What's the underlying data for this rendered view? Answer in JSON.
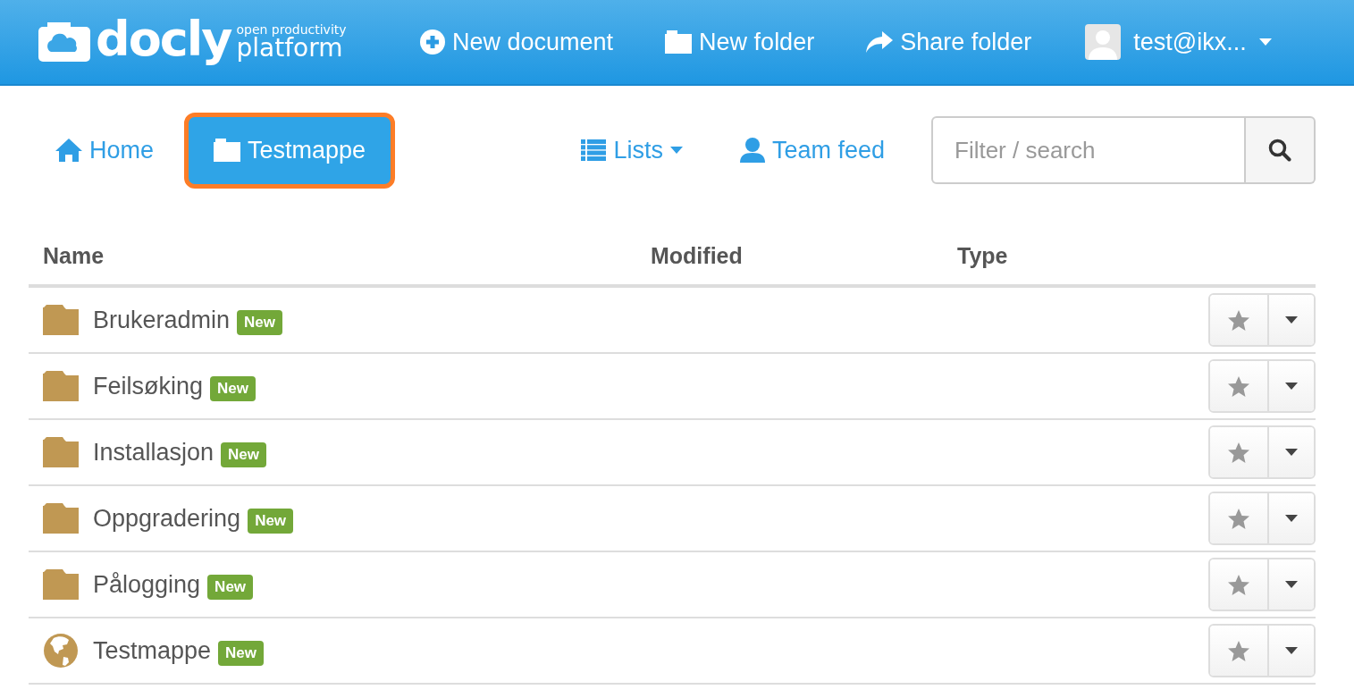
{
  "header": {
    "logo": {
      "name": "docly",
      "tagline_top": "open productivity",
      "tagline_bottom": "platform"
    },
    "actions": [
      {
        "kind": "plus",
        "label": "New document"
      },
      {
        "kind": "folder",
        "label": "New folder"
      },
      {
        "kind": "share",
        "label": "Share folder"
      }
    ],
    "user": {
      "label": "test@ikx..."
    }
  },
  "breadcrumb": [
    {
      "kind": "home",
      "label": "Home",
      "selected": false
    },
    {
      "kind": "folder",
      "label": "Testmappe",
      "selected": true
    }
  ],
  "toolbar": {
    "lists": "Lists",
    "team_feed": "Team feed",
    "search": {
      "placeholder": "Filter / search"
    }
  },
  "table": {
    "columns": [
      "Name",
      "Modified",
      "Type"
    ],
    "rows": [
      {
        "kind": "folder",
        "name": "Brukeradmin",
        "badge": "New"
      },
      {
        "kind": "folder",
        "name": "Feilsøking",
        "badge": "New"
      },
      {
        "kind": "folder",
        "name": "Installasjon",
        "badge": "New"
      },
      {
        "kind": "folder",
        "name": "Oppgradering",
        "badge": "New"
      },
      {
        "kind": "folder",
        "name": "Pålogging",
        "badge": "New"
      },
      {
        "kind": "globe",
        "name": "Testmappe",
        "badge": "New"
      }
    ]
  }
}
